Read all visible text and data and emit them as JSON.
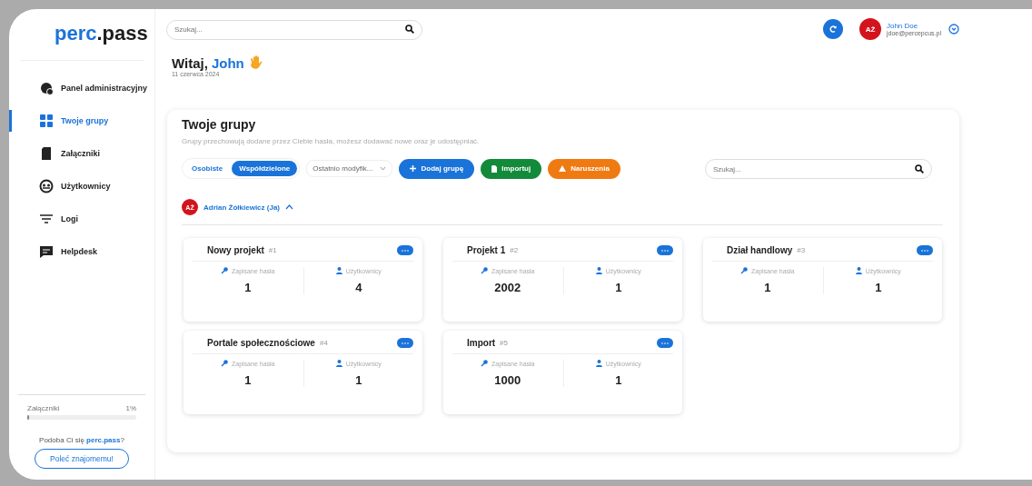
{
  "sidebar": {
    "logo": {
      "part_1": "perc",
      "part_2": ".pass"
    },
    "items": [
      {
        "label": "Panel administracyjny",
        "selected": false
      },
      {
        "label": "Twoje grupy",
        "selected": true
      },
      {
        "label": "Załączniki",
        "selected": false
      },
      {
        "label": "Użytkownicy",
        "selected": false
      },
      {
        "label": "Logi",
        "selected": false
      },
      {
        "label": "Helpdesk",
        "selected": false
      }
    ],
    "storage": {
      "label": "Załączniki",
      "reading": "1%",
      "level": 0.01
    },
    "promo": {
      "text": "Podoba Ci się **perc.pass**?",
      "button": "Poleć znajomemu!"
    }
  },
  "topbar": {
    "search": {
      "placeholder": "Szukaj..."
    },
    "user": {
      "initials": "AŻ",
      "name": "John Doe",
      "email": "jdoe@percepcus.pl"
    }
  },
  "greeting": {
    "text": "Witaj,",
    "name": "John",
    "date": "11 czerwca 2024"
  },
  "groups": {
    "title": "Twoje grupy",
    "description": "Grupy przechowują dodane przez Ciebie hasła, możesz dodawać nowe oraz je udostępniać.",
    "tabs": [
      {
        "label": "Osobiste",
        "selected": false
      },
      {
        "label": "Współdzielone",
        "selected": true
      }
    ],
    "sort": {
      "value": "Ostatnio modyfik..."
    },
    "buttons": [
      {
        "label": "Dodaj grupę",
        "kind": "add"
      },
      {
        "label": "Importuj",
        "kind": "import"
      },
      {
        "label": "Naruszenia",
        "kind": "breach"
      }
    ],
    "search": {
      "placeholder": "Szukaj..."
    },
    "owner": {
      "initials": "AŻ",
      "name": "Adrian Żółkiewicz (Ja)",
      "expanded": true
    },
    "cards": [
      {
        "title": "Nowy projekt",
        "id": "#1",
        "stat_1_label": "Zapisane hasła",
        "stat_1_value": "1",
        "stat_2_label": "Użytkownicy",
        "stat_2_value": "4"
      },
      {
        "title": "Projekt 1",
        "id": "#2",
        "stat_1_label": "Zapisane hasła",
        "stat_1_value": "2002",
        "stat_2_label": "Użytkownicy",
        "stat_2_value": "1"
      },
      {
        "title": "Dział handlowy",
        "id": "#3",
        "stat_1_label": "Zapisane hasła",
        "stat_1_value": "1",
        "stat_2_label": "Użytkownicy",
        "stat_2_value": "1"
      },
      {
        "title": "Portale społecznościowe",
        "id": "#4",
        "stat_1_label": "Zapisane hasła",
        "stat_1_value": "1",
        "stat_2_label": "Użytkownicy",
        "stat_2_value": "1"
      },
      {
        "title": "Import",
        "id": "#5",
        "stat_1_label": "Zapisane hasła",
        "stat_1_value": "1000",
        "stat_2_label": "Użytkownicy",
        "stat_2_value": "1"
      }
    ]
  }
}
